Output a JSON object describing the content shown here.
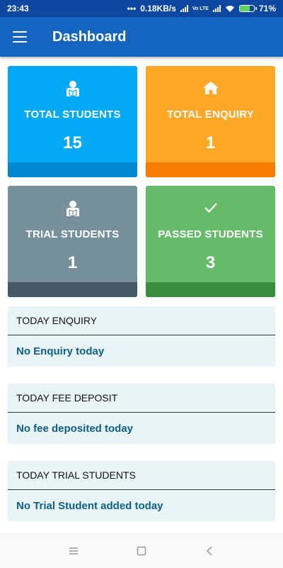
{
  "status_bar": {
    "time": "23:43",
    "dots": "•••",
    "speed": "0.18KB/s",
    "volte": "Vo LTE",
    "battery": "71%",
    "battery_level": 0.71
  },
  "app_bar": {
    "title": "Dashboard"
  },
  "tiles": [
    {
      "label": "TOTAL STUDENTS",
      "count": "15",
      "icon": "student-icon",
      "color": "#03a9f4",
      "footer_color": "#0288d1"
    },
    {
      "label": "TOTAL ENQUIRY",
      "count": "1",
      "icon": "home-icon",
      "color": "#ffa726",
      "footer_color": "#f57c00"
    },
    {
      "label": "TRIAL STUDENTS",
      "count": "1",
      "icon": "student-icon",
      "color": "#78909c",
      "footer_color": "#455a64"
    },
    {
      "label": "PASSED STUDENTS",
      "count": "3",
      "icon": "check-icon",
      "color": "#66bb6a",
      "footer_color": "#388e3c"
    }
  ],
  "cards": [
    {
      "title": "TODAY ENQUIRY",
      "message": "No Enquiry today"
    },
    {
      "title": "TODAY FEE DEPOSIT",
      "message": "No fee deposited today"
    },
    {
      "title": "TODAY TRIAL STUDENTS",
      "message": "No Trial Student added today"
    }
  ],
  "nav_bar": {
    "buttons": [
      "menu-icon",
      "home-square-icon",
      "back-icon"
    ]
  }
}
